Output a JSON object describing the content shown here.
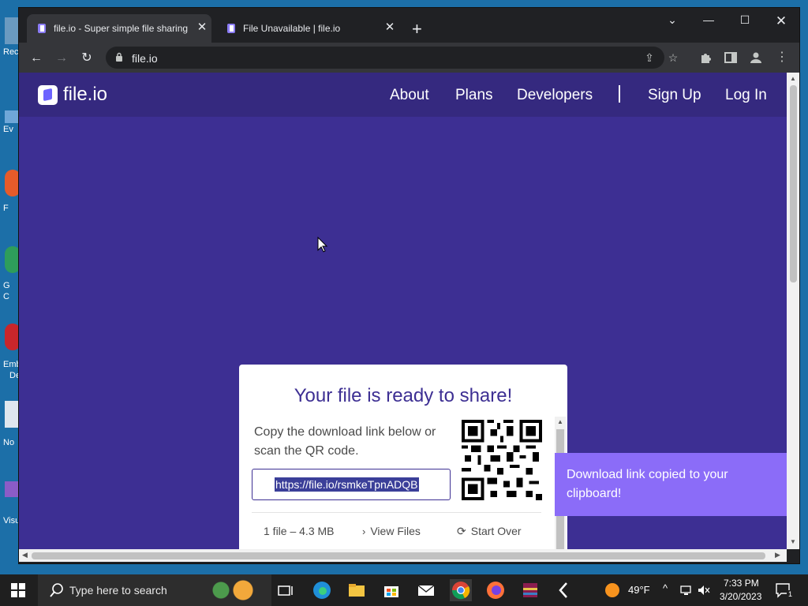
{
  "desktop": {
    "labels": [
      "Rec",
      "Ev",
      "F",
      "G",
      "C",
      "Emb",
      "De",
      "No",
      "Visu"
    ]
  },
  "browser": {
    "tabs": [
      {
        "title": "file.io - Super simple file sharing",
        "active": true
      },
      {
        "title": "File Unavailable | file.io",
        "active": false
      }
    ],
    "url": "file.io"
  },
  "site": {
    "logo_text": "file.io",
    "nav": {
      "about": "About",
      "plans": "Plans",
      "developers": "Developers",
      "sign_up": "Sign Up",
      "log_in": "Log In"
    },
    "card": {
      "title": "Your file is ready to share!",
      "description": "Copy the download link below or scan the QR code.",
      "link": "https://file.io/rsmkeTpnADQB",
      "file_info": "1 file – 4.3 MB",
      "view_files": "View Files",
      "start_over": "Start Over"
    },
    "toast": "Download link copied to your clipboard!"
  },
  "taskbar": {
    "search_placeholder": "Type here to search",
    "weather": "49°F",
    "time": "7:33 PM",
    "date": "3/20/2023",
    "notification_count": "1"
  },
  "colors": {
    "page_bg": "#3d2f93",
    "header_bg": "#35297f",
    "toast_bg": "#8b6cf8",
    "chrome_dark": "#202124"
  }
}
